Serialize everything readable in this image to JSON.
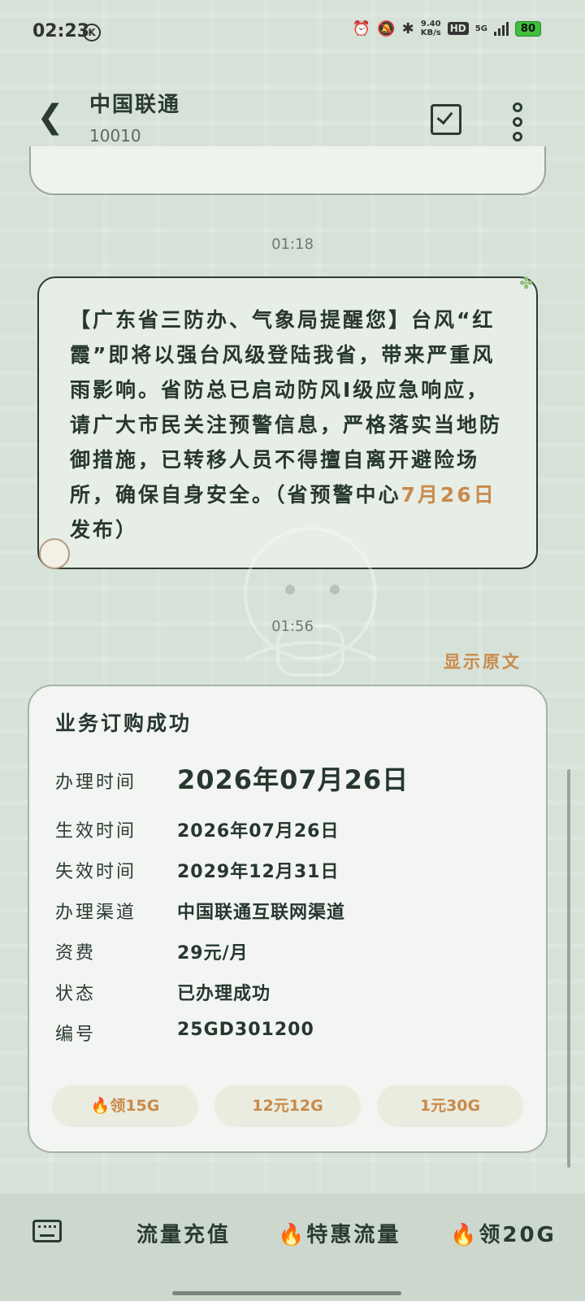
{
  "status_bar": {
    "time": "02:23",
    "k_badge": "K",
    "net_speed_top": "9.40",
    "net_speed_unit": "KB/s",
    "hd": "HD",
    "network": "5G",
    "battery": "80"
  },
  "header": {
    "title": "中国联通",
    "subtitle": "10010"
  },
  "messages": [
    {
      "time": "01:18",
      "text_main": "【广东省三防办、气象局提醒您】台风“红霞”即将以强台风级登陆我省，带来严重风雨影响。省防总已启动防风Ⅰ级应急响应，请广大市民关注预警信息，严格落实当地防御措施，已转移人员不得擅自离开避险场所，确保自身安全。（省预警中心",
      "text_date": "7月26日",
      "text_end": "发布）"
    },
    {
      "time": "01:56",
      "show_original": "显示原文"
    }
  ],
  "card": {
    "title": "业务订购成功",
    "rows": [
      {
        "label": "办理时间",
        "value": "2026年07月26日"
      },
      {
        "label": "生效时间",
        "value": "2026年07月26日"
      },
      {
        "label": "失效时间",
        "value": "2029年12月31日"
      },
      {
        "label": "办理渠道",
        "value": "中国联通互联网渠道"
      },
      {
        "label": "资费",
        "value": "29元/月"
      },
      {
        "label": "状态",
        "value": "已办理成功"
      },
      {
        "label": "编号",
        "value": "25GD301200"
      }
    ],
    "buttons": [
      "领15G",
      "12元12G",
      "1元30G"
    ]
  },
  "bottom_menu": [
    "流量充值",
    "特惠流量",
    "领20G"
  ]
}
